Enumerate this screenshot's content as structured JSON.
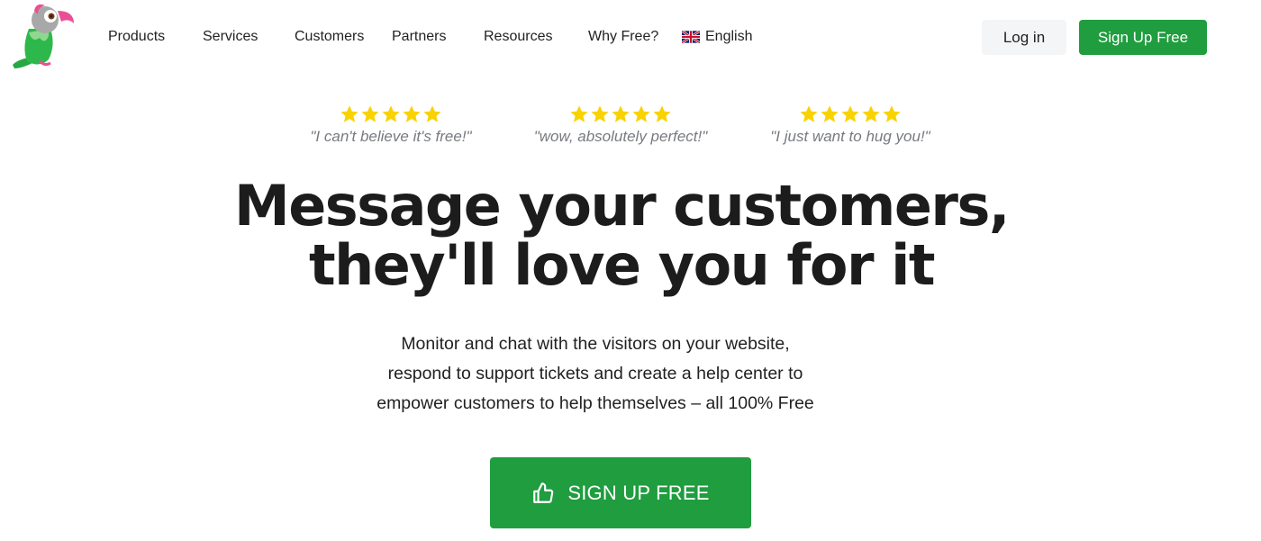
{
  "header": {
    "logo_alt": "Parrot logo",
    "nav": [
      {
        "label": "Products"
      },
      {
        "label": "Services"
      },
      {
        "label": "Customers"
      },
      {
        "label": "Partners"
      },
      {
        "label": "Resources"
      },
      {
        "label": "Why Free?"
      }
    ],
    "language": {
      "label": "English",
      "icon": "uk-flag-icon"
    },
    "login_label": "Log in",
    "signup_label": "Sign Up Free"
  },
  "reviews": [
    {
      "rating": 5,
      "quote": "\"I can't believe it's free!\""
    },
    {
      "rating": 5,
      "quote": "\"wow, absolutely perfect!\""
    },
    {
      "rating": 5,
      "quote": "\"I just want to hug you!\""
    }
  ],
  "hero": {
    "headline_line1": "Message your customers,",
    "headline_line2": "they'll love you for it",
    "sub_line1": "Monitor and chat with the visitors on your website,",
    "sub_line2": "respond to support tickets and create a help center to",
    "sub_line3": "empower customers to help themselves – all 100% Free",
    "cta_label": "SIGN UP FREE",
    "cta_icon": "thumbs-up-icon"
  },
  "colors": {
    "brand_green": "#1f9d3f",
    "star_yellow": "#f8d300",
    "quote_gray": "#777a80"
  }
}
